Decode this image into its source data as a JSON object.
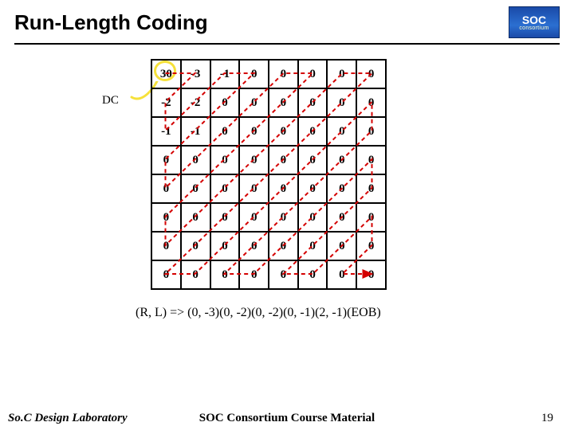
{
  "header": {
    "title": "Run-Length Coding",
    "logo_top": "SOC",
    "logo_bottom": "consortium"
  },
  "dc_label": "DC",
  "grid": [
    [
      "30",
      "-3",
      "-1",
      "0",
      "0",
      "0",
      "0",
      "0"
    ],
    [
      "-2",
      "-2",
      "0",
      "0",
      "0",
      "0",
      "0",
      "0"
    ],
    [
      "-1",
      "-1",
      "0",
      "0",
      "0",
      "0",
      "0",
      "0"
    ],
    [
      "0",
      "0",
      "0",
      "0",
      "0",
      "0",
      "0",
      "0"
    ],
    [
      "0",
      "0",
      "0",
      "0",
      "0",
      "0",
      "0",
      "0"
    ],
    [
      "0",
      "0",
      "0",
      "0",
      "0",
      "0",
      "0",
      "0"
    ],
    [
      "0",
      "0",
      "0",
      "0",
      "0",
      "0",
      "0",
      "0"
    ],
    [
      "0",
      "0",
      "0",
      "0",
      "0",
      "0",
      "0",
      "0"
    ]
  ],
  "rl_expression": "(R, L) => (0, -3)(0, -2)(0, -2)(0, -1)(2, -1)(EOB)",
  "footer": {
    "left": "So.C Design Laboratory",
    "center": "SOC Consortium Course Material",
    "page": "19"
  }
}
